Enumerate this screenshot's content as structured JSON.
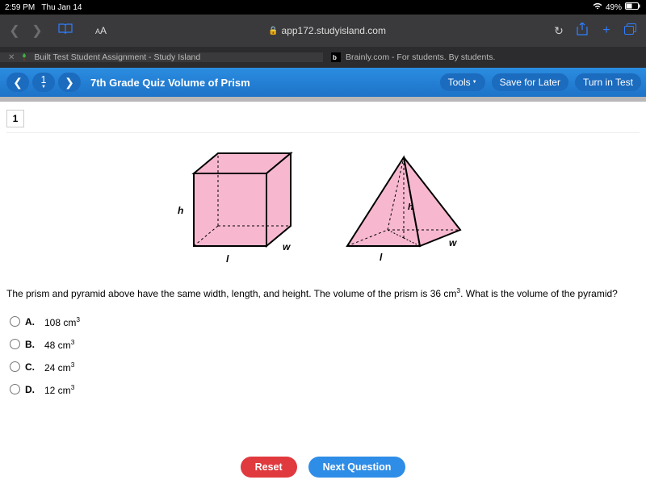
{
  "status": {
    "time": "2:59 PM",
    "date": "Thu Jan 14",
    "battery_pct": "49%"
  },
  "browser": {
    "url": "app172.studyisland.com",
    "tab_active": "Built Test Student Assignment - Study Island",
    "tab_other": "Brainly.com - For students. By students."
  },
  "quiz": {
    "title": "7th Grade Quiz Volume of Prism",
    "current_number": "1",
    "tools": "Tools",
    "save": "Save for Later",
    "turnin": "Turn in Test"
  },
  "question": {
    "number": "1",
    "prompt_pre": "The prism and pyramid above have the same width, length, and height. The volume of the prism is 36 cm",
    "prompt_sup": "3",
    "prompt_post": ". What is the volume of the pyramid?",
    "labels": {
      "h": "h",
      "w": "w",
      "l": "l"
    },
    "answers": {
      "A": {
        "letter": "A.",
        "val": "108 cm",
        "sup": "3"
      },
      "B": {
        "letter": "B.",
        "val": "48 cm",
        "sup": "3"
      },
      "C": {
        "letter": "C.",
        "val": "24 cm",
        "sup": "3"
      },
      "D": {
        "letter": "D.",
        "val": "12 cm",
        "sup": "3"
      }
    }
  },
  "buttons": {
    "reset": "Reset",
    "next": "Next Question"
  }
}
